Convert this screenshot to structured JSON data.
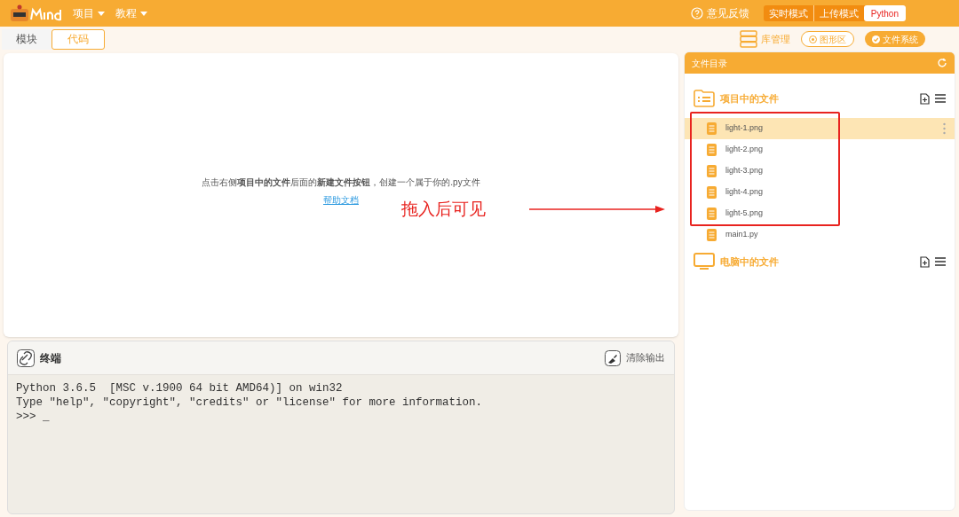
{
  "menu": [
    "项目",
    "教程"
  ],
  "feedback": "意见反馈",
  "modes": [
    {
      "label": "实时模式",
      "selected": false
    },
    {
      "label": "上传模式",
      "selected": false
    },
    {
      "label": "Python",
      "selected": true
    }
  ],
  "view_tabs": [
    {
      "label": "模块",
      "selected": false
    },
    {
      "label": "代码",
      "selected": true
    }
  ],
  "tools": [
    {
      "label": "库管理",
      "kind": "plain"
    },
    {
      "label": "图形区",
      "kind": "outline"
    },
    {
      "label": "文件系统",
      "kind": "filled"
    }
  ],
  "editor": {
    "hint": "点击右侧**项目中的文件**后面的**新建文件按钮**，创建一个属于你的.py文件",
    "help_link": "帮助文档"
  },
  "annotation": "拖入后可见",
  "terminal": {
    "title": "终端",
    "clear": "清除输出",
    "lines": [
      "Python 3.6.5  [MSC v.1900 64 bit AMD64)] on win32",
      "Type \"help\", \"copyright\", \"credits\" or \"license\" for more information.",
      ">>> _"
    ]
  },
  "file_panel": {
    "title": "文件目录",
    "sections": [
      {
        "title": "项目中的文件",
        "kind": "project",
        "files": [
          {
            "name": "light-1.png",
            "selected": true
          },
          {
            "name": "light-2.png",
            "selected": false
          },
          {
            "name": "light-3.png",
            "selected": false
          },
          {
            "name": "light-4.png",
            "selected": false
          },
          {
            "name": "light-5.png",
            "selected": false
          },
          {
            "name": "main1.py",
            "selected": false
          }
        ]
      },
      {
        "title": "电脑中的文件",
        "kind": "computer"
      }
    ]
  }
}
